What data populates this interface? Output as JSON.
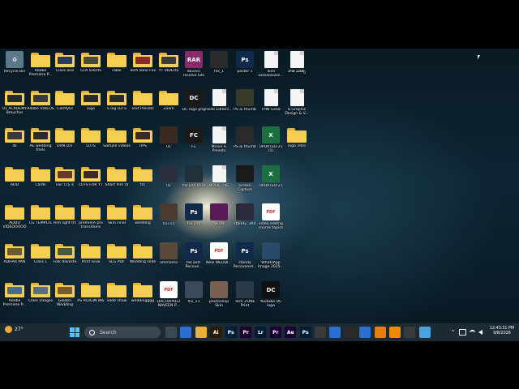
{
  "colors": {
    "folder": "#f6cf52",
    "taskbar": "#1c2a33",
    "accent": "#4cc2ff"
  },
  "desktop": {
    "columns": [
      [
        {
          "label": "Recycle Bin",
          "kind": "tile",
          "icon": "recycle-bin-icon",
          "bg": "#5a7a8c",
          "text": "♻"
        },
        {
          "label": "01 ACADEMY Brouchor",
          "kind": "folder",
          "icon": "folder-icon",
          "thumb": "#2a2a2a"
        },
        {
          "label": "4k",
          "kind": "folder",
          "icon": "folder-icon",
          "thumb": "#3a3a3a"
        },
        {
          "label": "ADD",
          "kind": "folder",
          "icon": "folder-icon",
          "thumb": ""
        },
        {
          "label": "ADDD VIDEOOOOO",
          "kind": "folder",
          "icon": "folder-icon",
          "thumb": ""
        },
        {
          "label": "ADHAR PAN",
          "kind": "folder",
          "icon": "folder-icon",
          "thumb": "#6b5a2a"
        },
        {
          "label": "Adobe Premiere P...",
          "kind": "folder",
          "icon": "folder-icon",
          "thumb": "#4a6a8a"
        }
      ],
      [
        {
          "label": "Adobe Premiere P...",
          "kind": "folder",
          "icon": "folder-icon",
          "thumb": ""
        },
        {
          "label": "Adobe VIDEOS",
          "kind": "folder",
          "icon": "folder-icon",
          "thumb": "#3a3a3a"
        },
        {
          "label": "AE wedding titels",
          "kind": "folder",
          "icon": "folder-icon",
          "thumb": "#2b2b2b"
        },
        {
          "label": "Cards",
          "kind": "folder",
          "icon": "folder-icon",
          "thumb": ""
        },
        {
          "label": "CG TEMPLTE",
          "kind": "folder",
          "icon": "folder-icon",
          "thumb": ""
        },
        {
          "label": "Class 1",
          "kind": "folder",
          "icon": "folder-icon",
          "thumb": ""
        },
        {
          "label": "Class images",
          "kind": "folder",
          "icon": "folder-icon",
          "thumb": "#5a7080"
        }
      ],
      [
        {
          "label": "Class one",
          "kind": "folder",
          "icon": "folder-icon",
          "thumb": "#2a3a5a"
        },
        {
          "label": "ComfyUI",
          "kind": "folder",
          "icon": "folder-icon",
          "thumb": ""
        },
        {
          "label": "DVN LUT",
          "kind": "folder",
          "icon": "folder-icon",
          "thumb": ""
        },
        {
          "label": "Fair Cry 4",
          "kind": "folder",
          "icon": "folder-icon",
          "thumb": "#6a3a2a"
        },
        {
          "label": "Film light trc",
          "kind": "folder",
          "icon": "folder-icon",
          "thumb": ""
        },
        {
          "label": "Folk daveste",
          "kind": "folder",
          "icon": "folder-icon",
          "thumb": "#4a5a3a"
        },
        {
          "label": "Golden Wedding",
          "kind": "folder",
          "icon": "folder-icon",
          "thumb": "#7a5a2a"
        }
      ],
      [
        {
          "label": "GTA SHorts",
          "kind": "folder",
          "icon": "folder-icon",
          "thumb": "#4a4a3a"
        },
        {
          "label": "logo",
          "kind": "folder",
          "icon": "folder-icon",
          "thumb": "#2a2a2a"
        },
        {
          "label": "LUTS",
          "kind": "folder",
          "icon": "folder-icon",
          "thumb": ""
        },
        {
          "label": "LUTS FOR YT",
          "kind": "folder",
          "icon": "folder-icon",
          "thumb": "#3a2a2a"
        },
        {
          "label": "premiere pro transitions",
          "kind": "folder",
          "icon": "folder-icon",
          "thumb": ""
        },
        {
          "label": "Print Final",
          "kind": "folder",
          "icon": "folder-icon",
          "thumb": ""
        },
        {
          "label": "PS PLUGIN INS",
          "kind": "folder",
          "icon": "folder-icon",
          "thumb": ""
        }
      ],
      [
        {
          "label": "rabik",
          "kind": "folder",
          "icon": "folder-icon",
          "thumb": ""
        },
        {
          "label": "S log LUTS",
          "kind": "folder",
          "icon": "folder-icon",
          "thumb": "#2a2a2a"
        },
        {
          "label": "Sample videos",
          "kind": "folder",
          "icon": "folder-icon",
          "thumb": ""
        },
        {
          "label": "Short film ra",
          "kind": "folder",
          "icon": "folder-icon",
          "thumb": ""
        },
        {
          "label": "Skin Final",
          "kind": "folder",
          "icon": "folder-icon",
          "thumb": ""
        },
        {
          "label": "SLG PDF",
          "kind": "folder",
          "icon": "folder-icon",
          "thumb": ""
        },
        {
          "label": "Slide show",
          "kind": "folder",
          "icon": "folder-icon",
          "thumb": ""
        }
      ],
      [
        {
          "label": "Tech zone Flix",
          "kind": "folder",
          "icon": "folder-icon",
          "thumb": "#8a2a2a"
        },
        {
          "label": "Text Presets",
          "kind": "folder",
          "icon": "folder-icon",
          "thumb": ""
        },
        {
          "label": "TIPS",
          "kind": "folder",
          "icon": "folder-icon",
          "thumb": "#3a2a2a"
        },
        {
          "label": "trc",
          "kind": "folder",
          "icon": "folder-icon",
          "thumb": ""
        },
        {
          "label": "wedding",
          "kind": "folder",
          "icon": "folder-icon",
          "thumb": ""
        },
        {
          "label": "Wedding slide",
          "kind": "folder",
          "icon": "folder-icon",
          "thumb": ""
        },
        {
          "label": "weddingggg",
          "kind": "folder",
          "icon": "folder-icon",
          "thumb": ""
        }
      ],
      [
        {
          "label": "YT VIDEOS",
          "kind": "folder",
          "icon": "folder-icon",
          "thumb": "#3a3a3a"
        },
        {
          "label": "Zoom",
          "kind": "folder",
          "icon": "folder-icon",
          "thumb": ""
        },
        {
          "label": "01",
          "kind": "tile",
          "icon": "video-thumbnail-icon",
          "bg": "#3a2a20",
          "text": ""
        },
        {
          "label": "01",
          "kind": "tile",
          "icon": "video-thumbnail-icon",
          "bg": "#2a3040",
          "text": ""
        },
        {
          "label": "01111",
          "kind": "tile",
          "icon": "image-thumbnail-icon",
          "bg": "#4a3a30",
          "text": ""
        },
        {
          "label": "ammama",
          "kind": "tile",
          "icon": "image-thumbnail-icon",
          "bg": "#5a4a3a",
          "text": ""
        },
        {
          "label": "DACHAPALLI NAVEEN P...",
          "kind": "tile",
          "icon": "pdf-icon",
          "bg": "#ffffff",
          "text": "PDF"
        }
      ],
      [
        {
          "label": "davinci resolve luts",
          "kind": "tile",
          "icon": "winrar-archive-icon",
          "bg": "#8a2a6a",
          "text": "RAR"
        },
        {
          "label": "DC logo png",
          "kind": "tile",
          "icon": "image-thumbnail-icon",
          "bg": "#1a1a1a",
          "text": "DC"
        },
        {
          "label": "FC",
          "kind": "tile",
          "icon": "image-thumbnail-icon",
          "bg": "#1a1a1a",
          "text": "FC"
        },
        {
          "label": "flix psd Print",
          "kind": "tile",
          "icon": "video-thumbnail-icon",
          "bg": "#20303a",
          "text": ""
        },
        {
          "label": "flix psd",
          "kind": "tile",
          "icon": "photoshop-psd-icon",
          "bg": "#0f2a4a",
          "text": "Ps"
        },
        {
          "label": "flix psd-Recove...",
          "kind": "tile",
          "icon": "photoshop-psd-icon",
          "bg": "#0f2a4a",
          "text": "Ps"
        },
        {
          "label": "flix_11",
          "kind": "tile",
          "icon": "image-thumbnail-icon",
          "bg": "#3a4a5a",
          "text": ""
        }
      ],
      [
        {
          "label": "flix_1",
          "kind": "tile",
          "icon": "image-thumbnail-icon",
          "bg": "#2a2a2a",
          "text": ""
        },
        {
          "label": "Hello Editors...",
          "kind": "file",
          "icon": "document-icon"
        },
        {
          "label": "Movie Fi Presets",
          "kind": "file",
          "icon": "document-icon"
        },
        {
          "label": "MUSIC TRC",
          "kind": "file",
          "icon": "document-icon"
        },
        {
          "label": "NEON",
          "kind": "tile",
          "icon": "image-thumbnail-icon",
          "bg": "#5a1a5a",
          "text": ""
        },
        {
          "label": "New WEDDI...",
          "kind": "tile",
          "icon": "pdf-icon",
          "bg": "#ffffff",
          "text": "PDF"
        },
        {
          "label": "photoshop Skin",
          "kind": "tile",
          "icon": "image-thumbnail-icon",
          "bg": "#7a6050",
          "text": ""
        }
      ],
      [
        {
          "label": "poster 1",
          "kind": "tile",
          "icon": "photoshop-psd-icon",
          "bg": "#0f2a4a",
          "text": "Ps"
        },
        {
          "label": "PS ai thumb",
          "kind": "tile",
          "icon": "image-thumbnail-icon",
          "bg": "#3a3a2a",
          "text": ""
        },
        {
          "label": "PS ai thumb",
          "kind": "tile",
          "icon": "image-thumbnail-icon",
          "bg": "#2a2a2a",
          "text": ""
        },
        {
          "label": "Screen Capture",
          "kind": "tile",
          "icon": "image-thumbnail-icon",
          "bg": "#1a1a1a",
          "text": ""
        },
        {
          "label": "standy .3X4",
          "kind": "tile",
          "icon": "image-thumbnail-icon",
          "bg": "#2a2a3a",
          "text": ""
        },
        {
          "label": "standy Recovered...",
          "kind": "tile",
          "icon": "photoshop-psd-icon",
          "bg": "#0f2a4a",
          "text": "Ps"
        },
        {
          "label": "Tech ZONE Print",
          "kind": "tile",
          "icon": "image-thumbnail-icon",
          "bg": "#2a3a4a",
          "text": ""
        }
      ],
      [
        {
          "label": "Tech zzzzzzzzzzz...",
          "kind": "file",
          "icon": "document-icon"
        },
        {
          "label": "TPIN Grow",
          "kind": "file",
          "icon": "document-icon"
        },
        {
          "label": "UPDATED-21 (1)",
          "kind": "tile",
          "icon": "excel-icon",
          "bg": "#1d6f42",
          "text": "X"
        },
        {
          "label": "UPDATED-21",
          "kind": "tile",
          "icon": "excel-icon",
          "bg": "#1d6f42",
          "text": "X"
        },
        {
          "label": "video editing course topics",
          "kind": "tile",
          "icon": "pdf-icon",
          "bg": "#ffffff",
          "text": "PDF"
        },
        {
          "label": "WhatsApp Image 2025...",
          "kind": "tile",
          "icon": "image-thumbnail-icon",
          "bg": "#2a4a6a",
          "text": ""
        },
        {
          "label": "Youtube DC logo",
          "kind": "tile",
          "icon": "image-thumbnail-icon",
          "bg": "#101010",
          "text": "DC"
        }
      ],
      [
        {
          "label": "పాత ఎడిట్స్",
          "kind": "file",
          "icon": "document-icon"
        },
        {
          "label": "ద్ Graphic Design & V...",
          "kind": "file",
          "icon": "document-icon"
        },
        {
          "label": "logo intro",
          "kind": "folder",
          "icon": "folder-icon",
          "thumb": ""
        }
      ]
    ]
  },
  "taskbar": {
    "weather_temp": "27°",
    "search_placeholder": "Search",
    "pinned": [
      {
        "name": "task-view-icon",
        "bg": "#3a4a55",
        "text": ""
      },
      {
        "name": "chrome-icon",
        "bg": "#2b6fd4",
        "text": ""
      },
      {
        "name": "file-explorer-icon",
        "bg": "#e8b23a",
        "text": ""
      },
      {
        "name": "illustrator-icon",
        "bg": "#2b1a00",
        "text": "Ai"
      },
      {
        "name": "photoshop-icon",
        "bg": "#001e36",
        "text": "Ps"
      },
      {
        "name": "premiere-icon",
        "bg": "#1a0033",
        "text": "Pr"
      },
      {
        "name": "lightroom-icon",
        "bg": "#001a33",
        "text": "Lr"
      },
      {
        "name": "premiere-icon-2",
        "bg": "#1a0033",
        "text": "Pr"
      },
      {
        "name": "after-effects-icon",
        "bg": "#1a0033",
        "text": "Ae"
      },
      {
        "name": "photoshop-icon-2",
        "bg": "#001e36",
        "text": "Ps"
      },
      {
        "name": "davinci-resolve-icon",
        "bg": "#3a3a3a",
        "text": ""
      },
      {
        "name": "chrome-icon-2",
        "bg": "#2b6fd4",
        "text": ""
      },
      {
        "name": "epic-games-icon",
        "bg": "#2a2a2a",
        "text": ""
      },
      {
        "name": "chrome-icon-3",
        "bg": "#2b6fd4",
        "text": ""
      },
      {
        "name": "blender-icon",
        "bg": "#e87d0d",
        "text": ""
      },
      {
        "name": "vlc-icon",
        "bg": "#f08a00",
        "text": ""
      },
      {
        "name": "app-icon",
        "bg": "#3a3a3a",
        "text": ""
      },
      {
        "name": "notepad-icon",
        "bg": "#4aa3df",
        "text": ""
      }
    ],
    "tray_chevron": "^",
    "time": "12:43:31 PM",
    "date": "9/8/2026"
  }
}
